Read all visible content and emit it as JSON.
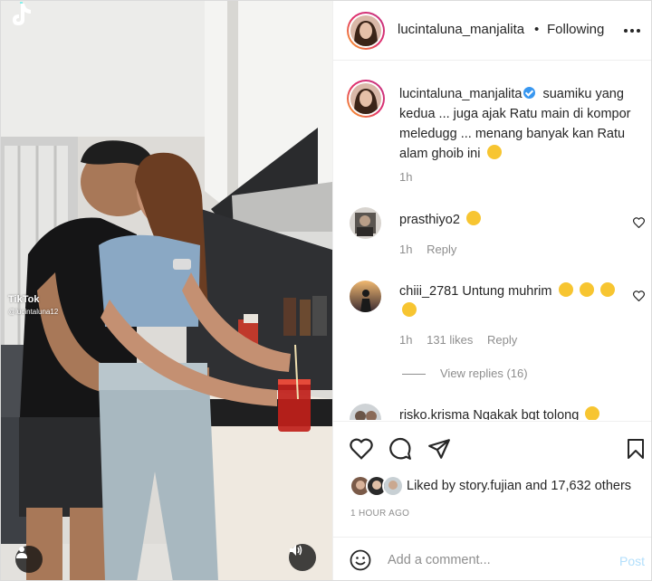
{
  "post": {
    "username": "lucintaluna_manjalita",
    "follow_state": "Following",
    "separator": "•",
    "caption": "suamiku yang kedua ... juga ajak Ratu main di kompor meledugg ... menang banyak kan Ratu alam ghoib ini",
    "caption_time": "1h"
  },
  "video": {
    "watermark_brand": "TikTok",
    "watermark_user": "@lucintaluna12"
  },
  "comments": [
    {
      "username": "prasthiyo2",
      "text": "",
      "time": "1h",
      "reply_label": "Reply"
    },
    {
      "username": "chiii_2781",
      "text": "Untung muhrim",
      "time": "1h",
      "likes": "131 likes",
      "reply_label": "Reply",
      "view_replies": "View replies (16)"
    },
    {
      "username": "risko.krisma",
      "text": "Ngakak bgt tolong"
    }
  ],
  "likes": {
    "prefix": "Liked by",
    "user": "story.fujian",
    "and": "and",
    "others": "17,632 others"
  },
  "posted": "1 HOUR AGO",
  "add_comment": {
    "placeholder": "Add a comment...",
    "post_label": "Post"
  },
  "colors": {
    "verified": "#3897f0",
    "muted": "#8e8e8e",
    "post_button_disabled": "#b2dffc",
    "avatar_ring": "#e1306c"
  }
}
